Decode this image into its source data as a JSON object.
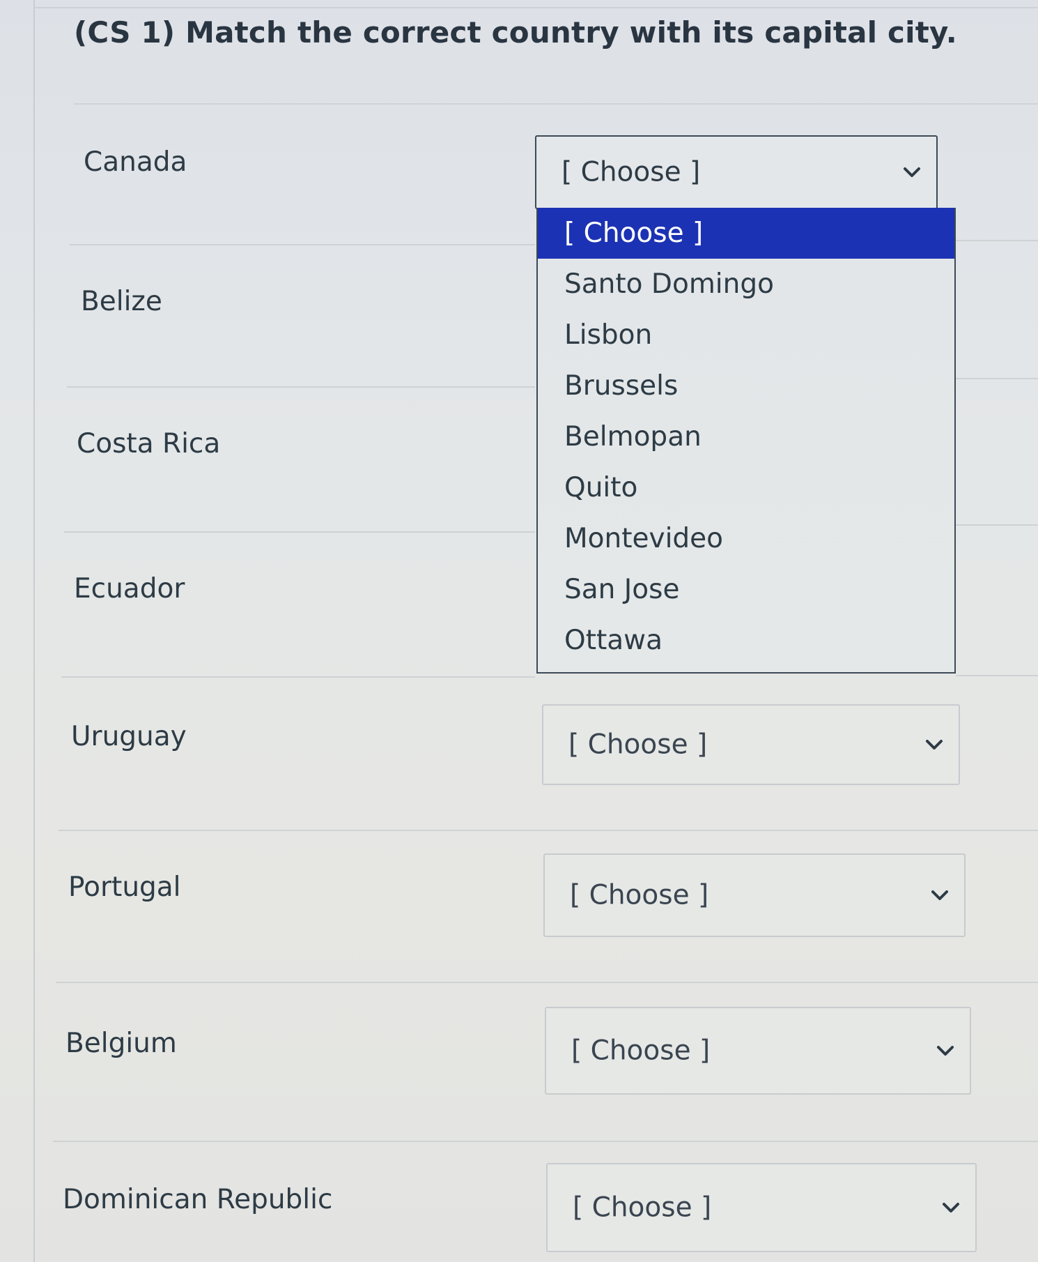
{
  "question": {
    "title": "(CS 1) Match the correct country with its capital city."
  },
  "rows": [
    {
      "country": "Canada",
      "select_value": "[ Choose ]",
      "open": true
    },
    {
      "country": "Belize"
    },
    {
      "country": "Costa Rica"
    },
    {
      "country": "Ecuador"
    },
    {
      "country": "Uruguay",
      "select_value": "[ Choose ]"
    },
    {
      "country": "Portugal",
      "select_value": "[ Choose ]"
    },
    {
      "country": "Belgium",
      "select_value": "[ Choose ]"
    },
    {
      "country": "Dominican Republic",
      "select_value": "[ Choose ]"
    }
  ],
  "dropdown": {
    "selected_index": 0,
    "options": [
      "[ Choose ]",
      "Santo Domingo",
      "Lisbon",
      "Brussels",
      "Belmopan",
      "Quito",
      "Montevideo",
      "San Jose",
      "Ottawa"
    ]
  },
  "colors": {
    "highlight": "#1c32b4",
    "text": "#2d3b45"
  },
  "icons": {
    "select_arrow": "chevron-down-icon"
  }
}
